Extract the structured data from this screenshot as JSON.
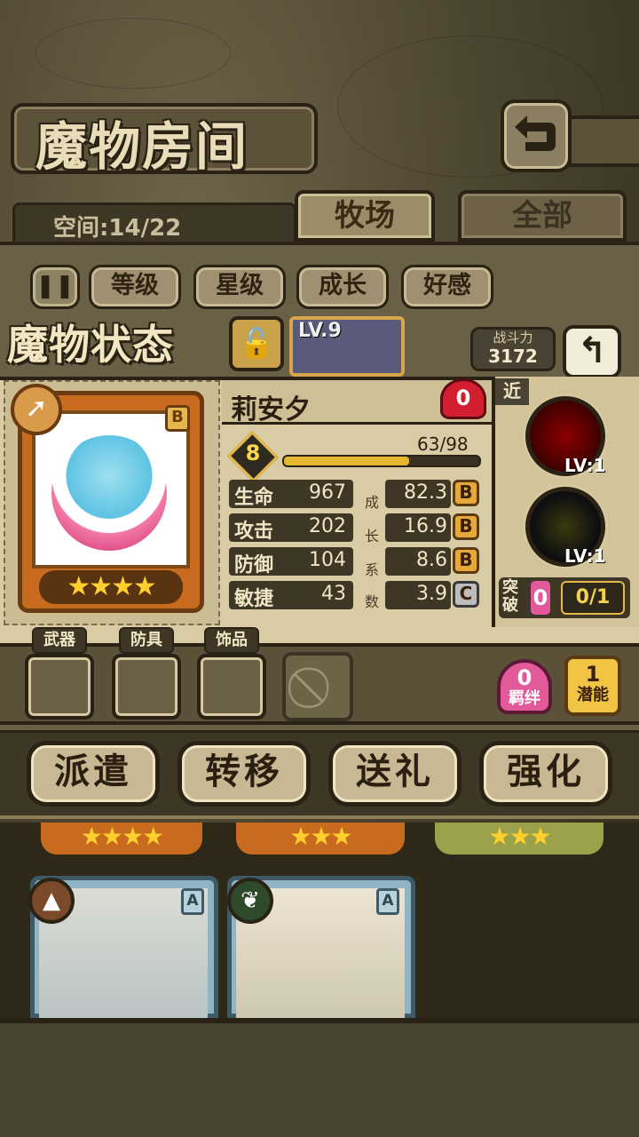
{
  "header": {
    "title": "魔物房间"
  },
  "ranch": {
    "space_label": "空间:14/22"
  },
  "tabs": [
    {
      "label": "牧场"
    },
    {
      "label": "全部"
    }
  ],
  "filters": [
    {
      "label": "等级"
    },
    {
      "label": "星级"
    },
    {
      "label": "成长"
    },
    {
      "label": "好感"
    }
  ],
  "status": {
    "title": "魔物状态",
    "peek_lv": "LV.9",
    "power_label": "战斗力",
    "power_value": "3172"
  },
  "monster": {
    "name": "莉安夕",
    "affection": "0",
    "rank": "B",
    "stars": "★★★★",
    "level": "8",
    "exp_text": "63/98",
    "exp_fraction": 0.643,
    "stats": [
      {
        "label": "生命",
        "value": "967",
        "growth": "82.3",
        "grade": "B"
      },
      {
        "label": "攻击",
        "value": "202",
        "growth": "16.9",
        "grade": "B"
      },
      {
        "label": "防御",
        "value": "104",
        "growth": "8.6",
        "grade": "B"
      },
      {
        "label": "敏捷",
        "value": "43",
        "growth": "3.9",
        "grade": "C"
      }
    ],
    "growth_chars": [
      "成",
      "长",
      "系",
      "数"
    ]
  },
  "skills": {
    "range_tag": "近",
    "items": [
      {
        "icon": "fang-mouth-icon",
        "lv": "LV:1"
      },
      {
        "icon": "lightning-icon",
        "lv": "LV:1"
      }
    ],
    "breakthrough_label": "突破",
    "breakthrough_count": "0",
    "breakthrough_value": "0/1"
  },
  "equipment": {
    "slots": [
      {
        "label": "武器"
      },
      {
        "label": "防具"
      },
      {
        "label": "饰品"
      }
    ],
    "bond_count": "0",
    "bond_label": "羁绊",
    "potential_count": "1",
    "potential_label": "潜能"
  },
  "actions": [
    {
      "label": "派遣"
    },
    {
      "label": "转移"
    },
    {
      "label": "送礼"
    },
    {
      "label": "强化"
    }
  ],
  "lower_cards": [
    {
      "rank": "A",
      "element": "mountain-icon"
    },
    {
      "rank": "A",
      "element": "leaf-icon"
    }
  ],
  "colors": {
    "accent": "#e8b732",
    "heart": "#d21e2e",
    "bond": "#e25a9a",
    "potential": "#f1c444"
  }
}
